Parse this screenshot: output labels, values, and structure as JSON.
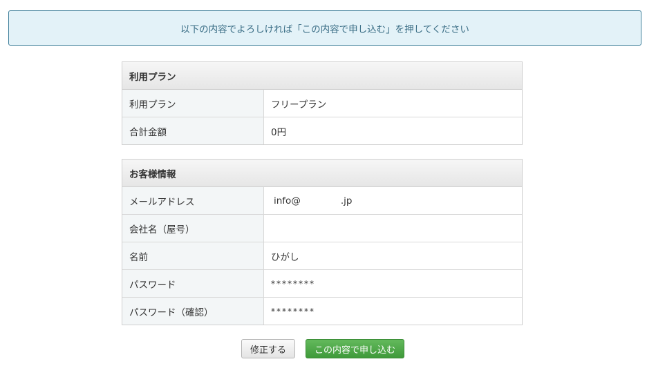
{
  "notice": {
    "text": "以下の内容でよろしければ「この内容で申し込む」を押してください"
  },
  "plan_section": {
    "title": "利用プラン",
    "rows": [
      {
        "label": "利用プラン",
        "value": "フリープラン"
      },
      {
        "label": "合計金額",
        "value": "0円"
      }
    ]
  },
  "customer_section": {
    "title": "お客様情報",
    "rows": [
      {
        "label": "メールアドレス",
        "value_prefix": "info@",
        "value_suffix": ".jp"
      },
      {
        "label": "会社名（屋号）",
        "value": ""
      },
      {
        "label": "名前",
        "value": "ひがし"
      },
      {
        "label": "パスワード",
        "value": "********"
      },
      {
        "label": "パスワード（確認）",
        "value": "********"
      }
    ]
  },
  "buttons": {
    "edit_label": "修正する",
    "submit_label": "この内容で申し込む"
  },
  "colors": {
    "notice_bg": "#e3f2f8",
    "notice_border": "#3f7f9a",
    "submit_green": "#4aa544"
  }
}
